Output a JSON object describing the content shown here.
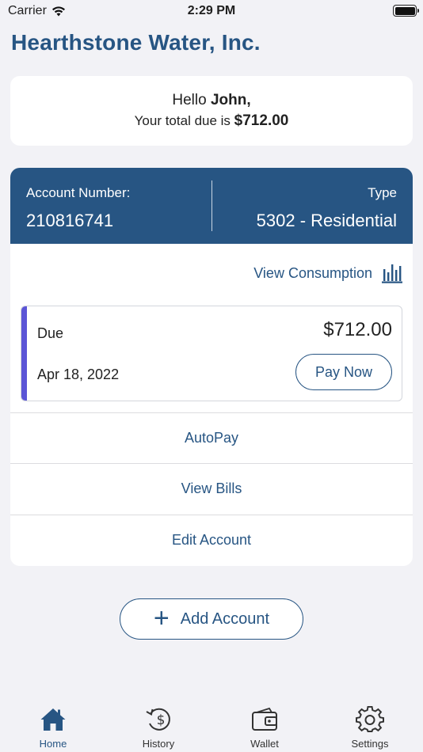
{
  "status_bar": {
    "carrier": "Carrier",
    "time": "2:29 PM"
  },
  "app": {
    "title": "Hearthstone Water, Inc."
  },
  "greeting": {
    "hello": "Hello",
    "name": "John,",
    "total_text": "Your total due is",
    "total_amount": "$712.00"
  },
  "account": {
    "number_label": "Account Number:",
    "number_value": "210816741",
    "type_label": "Type",
    "type_value": "5302 - Residential",
    "view_consumption_label": "View Consumption"
  },
  "bill": {
    "status_label": "Due",
    "amount": "$712.00",
    "date": "Apr 18, 2022",
    "pay_button_label": "Pay Now"
  },
  "actions": {
    "autopay": "AutoPay",
    "view_bills": "View Bills",
    "edit_account": "Edit Account"
  },
  "add_account_label": "Add Account",
  "tabs": [
    {
      "label": "Home",
      "icon": "home-icon",
      "active": true
    },
    {
      "label": "History",
      "icon": "history-icon",
      "active": false
    },
    {
      "label": "Wallet",
      "icon": "wallet-icon",
      "active": false
    },
    {
      "label": "Settings",
      "icon": "settings-icon",
      "active": false
    }
  ],
  "colors": {
    "brand": "#275583",
    "accent": "#5b55d6",
    "background": "#f2f2f6"
  }
}
